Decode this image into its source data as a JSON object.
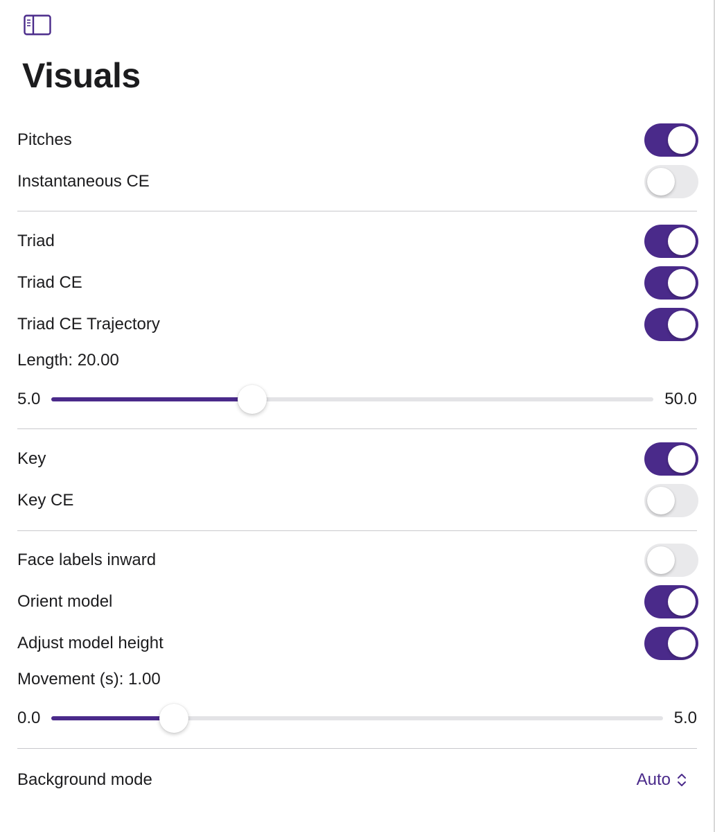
{
  "header": {
    "sidebar_icon": "sidebar-left-icon",
    "title": "Visuals"
  },
  "sections": {
    "pitches": {
      "label": "Pitches",
      "on": true
    },
    "instantaneous_ce": {
      "label": "Instantaneous CE",
      "on": false
    },
    "triad": {
      "label": "Triad",
      "on": true
    },
    "triad_ce": {
      "label": "Triad CE",
      "on": true
    },
    "triad_ce_trajectory": {
      "label": "Triad CE Trajectory",
      "on": true
    },
    "length_slider": {
      "caption": "Length: 20.00",
      "min_label": "5.0",
      "max_label": "50.0",
      "min": 5.0,
      "max": 50.0,
      "value": 20.0
    },
    "key": {
      "label": "Key",
      "on": true
    },
    "key_ce": {
      "label": "Key CE",
      "on": false
    },
    "face_labels_inward": {
      "label": "Face labels inward",
      "on": false
    },
    "orient_model": {
      "label": "Orient model",
      "on": true
    },
    "adjust_model_height": {
      "label": "Adjust model height",
      "on": true
    },
    "movement_slider": {
      "caption": "Movement (s): 1.00",
      "min_label": "0.0",
      "max_label": "5.0",
      "min": 0.0,
      "max": 5.0,
      "value": 1.0
    },
    "background_mode": {
      "label": "Background mode",
      "value": "Auto",
      "icon": "chevron-up-down-icon"
    }
  },
  "colors": {
    "accent": "#4a2a8a",
    "toggle_off": "#e9e9eb",
    "track_off": "#e3e3e6",
    "divider": "#c8c8cc"
  }
}
